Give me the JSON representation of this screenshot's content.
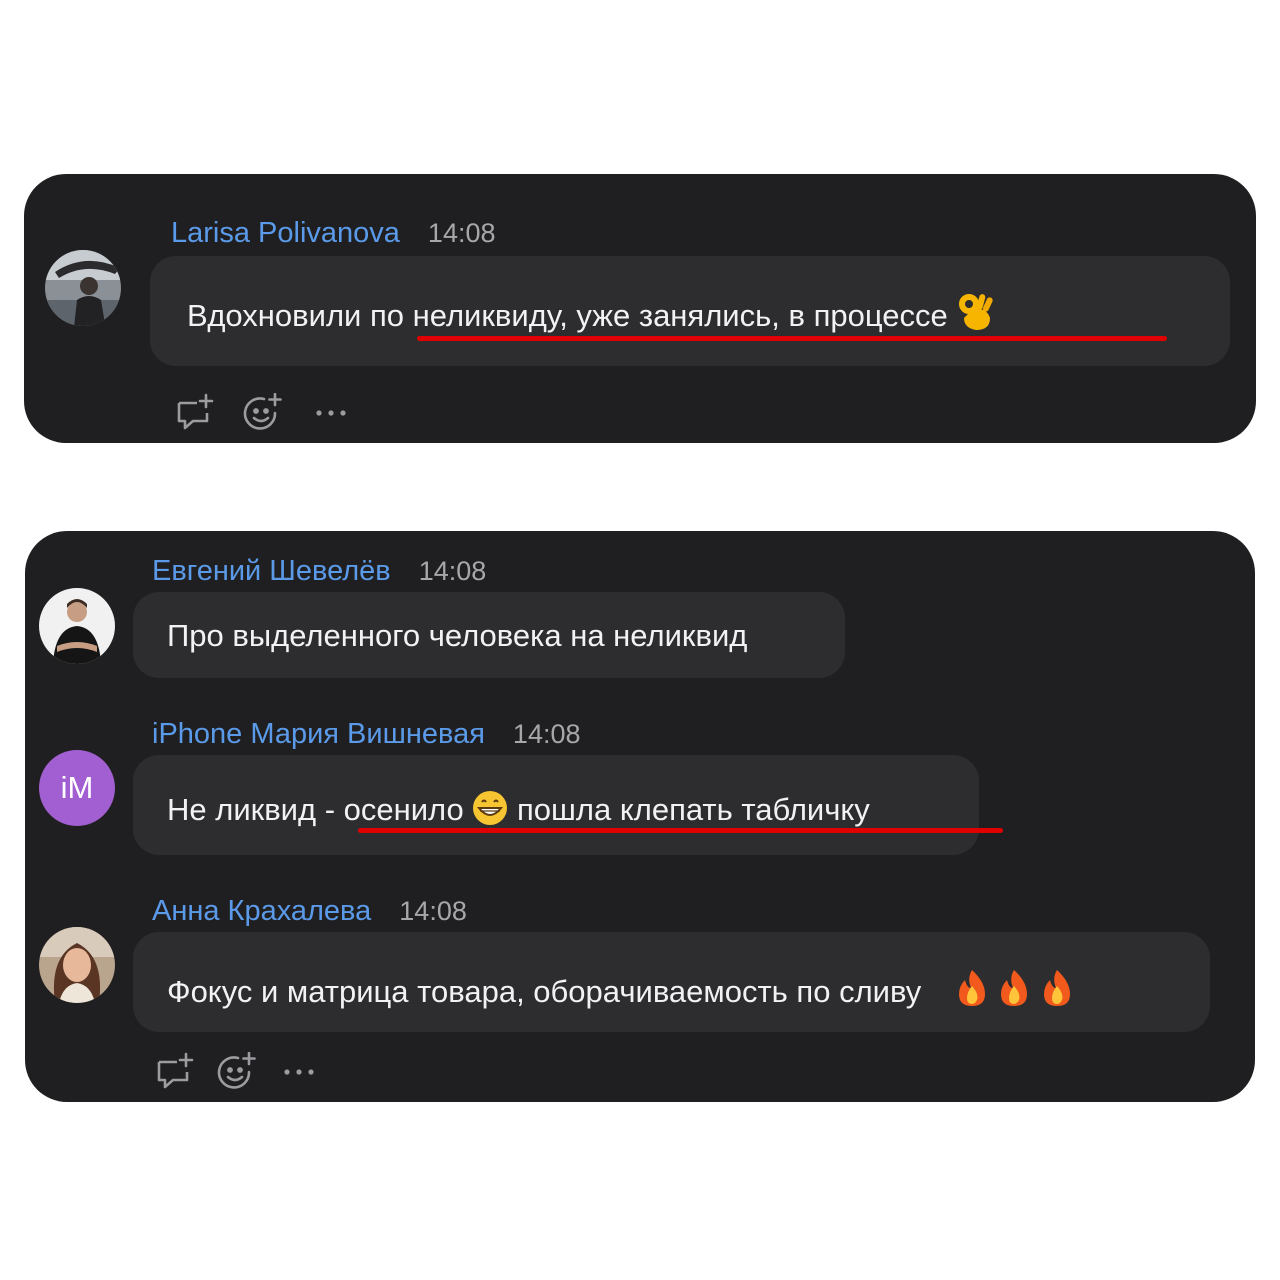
{
  "panel1": {
    "message": {
      "author": "Larisa Polivanova",
      "time": "14:08",
      "text_before": "Вдохновили ",
      "text_highlight": "по неликвиду, уже занялись, в процессе",
      "emoji_icon": "ok-hand-icon"
    },
    "actions": [
      "reply-icon",
      "add-reaction-icon",
      "more-icon"
    ]
  },
  "panel2": {
    "messages": [
      {
        "author": "Евгений Шевелёв",
        "time": "14:08",
        "text": "Про выделенного человека на неликвид"
      },
      {
        "author": "iPhone Мария Вишневая",
        "time": "14:08",
        "avatar_initials": "iM",
        "text_before": "Не ликвид - ",
        "text_highlight_1": "осенило",
        "emoji_icon": "grinning-face-icon",
        "text_highlight_2": " пошла клепать табличку"
      },
      {
        "author": "Анна Крахалева",
        "time": "14:08",
        "text": "Фокус  и матрица товара, оборачиваемость по сливу",
        "emoji_icons": [
          "fire-icon",
          "fire-icon",
          "fire-icon"
        ]
      }
    ],
    "actions": [
      "reply-icon",
      "add-reaction-icon",
      "more-icon"
    ]
  },
  "colors": {
    "panel_bg": "#1f1f21",
    "bubble_bg": "#2d2d2f",
    "author": "#5b9ae8",
    "highlight_line": "#e10000",
    "avatar_im": "#a25fd1"
  }
}
